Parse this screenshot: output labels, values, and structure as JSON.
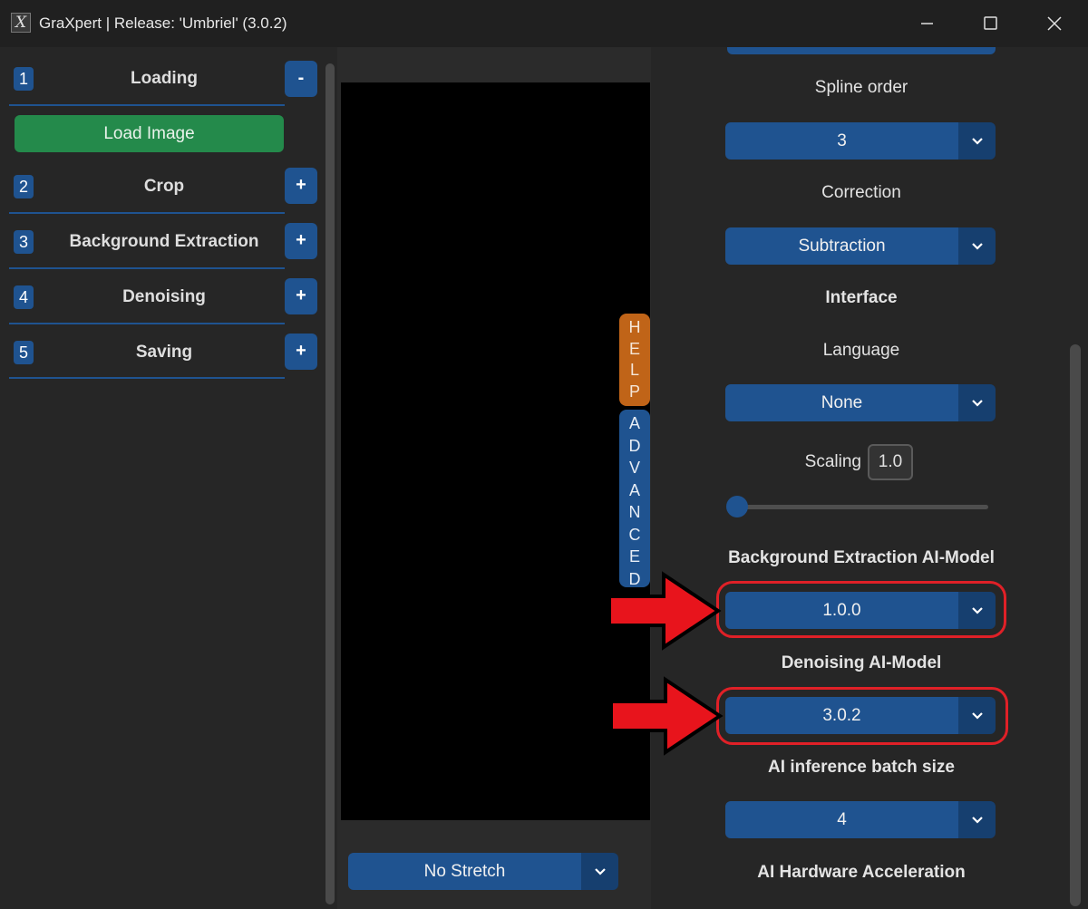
{
  "window": {
    "title": "GraXpert | Release: 'Umbriel' (3.0.2)",
    "logo_glyph": "X",
    "controls": {
      "minimize": "minimize-icon",
      "maximize": "maximize-icon",
      "close": "close-icon"
    }
  },
  "steps": [
    {
      "number": "1",
      "title": "Loading",
      "toggle": "-"
    },
    {
      "number": "2",
      "title": "Crop",
      "toggle": "+"
    },
    {
      "number": "3",
      "title": "Background Extraction",
      "toggle": "+"
    },
    {
      "number": "4",
      "title": "Denoising",
      "toggle": "+"
    },
    {
      "number": "5",
      "title": "Saving",
      "toggle": "+"
    }
  ],
  "load_image_label": "Load Image",
  "stretch": {
    "value": "No Stretch"
  },
  "side_tabs": {
    "help": [
      "H",
      "E",
      "L",
      "P"
    ],
    "advanced": [
      "A",
      "D",
      "V",
      "A",
      "N",
      "C",
      "E",
      "D"
    ]
  },
  "advanced": {
    "spline_order_label": "Spline order",
    "spline_order_value": "3",
    "correction_label": "Correction",
    "correction_value": "Subtraction",
    "interface_heading": "Interface",
    "language_label": "Language",
    "language_value": "None",
    "scaling_label": "Scaling",
    "scaling_value": "1.0",
    "scaling_slider_fraction": 0.0,
    "bg_model_label": "Background Extraction AI-Model",
    "bg_model_value": "1.0.0",
    "denoise_model_label": "Denoising AI-Model",
    "denoise_model_value": "3.0.2",
    "batch_size_label": "AI inference batch size",
    "batch_size_value": "4",
    "hw_accel_label": "AI Hardware Acceleration"
  },
  "colors": {
    "accent_blue": "#1f5390",
    "load_green": "#248a4b",
    "help_orange": "#c06418",
    "annotation_red": "#e8141c"
  }
}
